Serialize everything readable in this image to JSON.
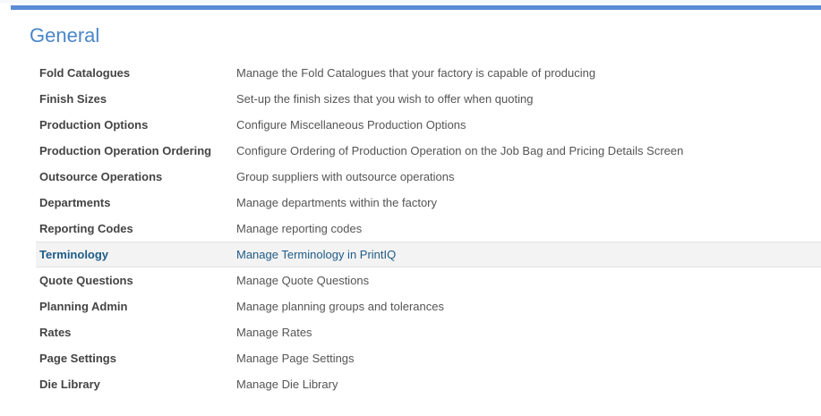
{
  "colors": {
    "accent_bar": "#5a8bd6",
    "title": "#4a86c8",
    "hover_row_bg": "#f3f3f3",
    "hover_text": "#1f5c88"
  },
  "section": {
    "title": "General"
  },
  "rows": [
    {
      "name": "Fold Catalogues",
      "description": "Manage the Fold Catalogues that your factory is capable of producing",
      "highlighted": false
    },
    {
      "name": "Finish Sizes",
      "description": "Set-up the finish sizes that you wish to offer when quoting",
      "highlighted": false
    },
    {
      "name": "Production Options",
      "description": "Configure Miscellaneous Production Options",
      "highlighted": false
    },
    {
      "name": "Production Operation Ordering",
      "description": "Configure Ordering of Production Operation on the Job Bag and Pricing Details Screen",
      "highlighted": false
    },
    {
      "name": "Outsource Operations",
      "description": "Group suppliers with outsource operations",
      "highlighted": false
    },
    {
      "name": "Departments",
      "description": "Manage departments within the factory",
      "highlighted": false
    },
    {
      "name": "Reporting Codes",
      "description": "Manage reporting codes",
      "highlighted": false
    },
    {
      "name": "Terminology",
      "description": "Manage Terminology in PrintIQ",
      "highlighted": true
    },
    {
      "name": "Quote Questions",
      "description": "Manage Quote Questions",
      "highlighted": false
    },
    {
      "name": "Planning Admin",
      "description": "Manage planning groups and tolerances",
      "highlighted": false
    },
    {
      "name": "Rates",
      "description": "Manage Rates",
      "highlighted": false
    },
    {
      "name": "Page Settings",
      "description": "Manage Page Settings",
      "highlighted": false
    },
    {
      "name": "Die Library",
      "description": "Manage Die Library",
      "highlighted": false
    }
  ]
}
